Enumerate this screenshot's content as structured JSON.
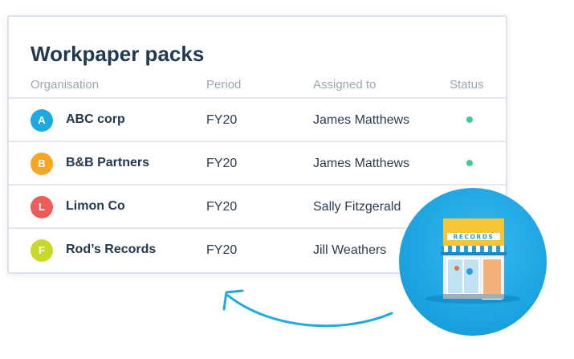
{
  "page": {
    "title": "Workpaper packs",
    "columns": {
      "organisation": "Organisation",
      "period": "Period",
      "assigned_to": "Assigned to",
      "status": "Status"
    },
    "rows": [
      {
        "avatar_letter": "A",
        "avatar_color": "#1fa9e3",
        "organisation": "ABC corp",
        "period": "FY20",
        "assigned_to": "James Matthews",
        "status_color": "#3ecf8e"
      },
      {
        "avatar_letter": "B",
        "avatar_color": "#f5a623",
        "organisation": "B&B Partners",
        "period": "FY20",
        "assigned_to": "James Matthews",
        "status_color": "#3ecf8e"
      },
      {
        "avatar_letter": "L",
        "avatar_color": "#ee5b5b",
        "organisation": "Limon Co",
        "period": "FY20",
        "assigned_to": "Sally Fitzgerald"
      },
      {
        "avatar_letter": "F",
        "avatar_color": "#c8d92c",
        "organisation": "Rod’s Records",
        "period": "FY20",
        "assigned_to": "Jill Weathers"
      }
    ]
  },
  "illustration": {
    "store_sign": "RECORDS",
    "arrow_color": "#1fa9e3",
    "circle_color": "#1ea6e3"
  }
}
